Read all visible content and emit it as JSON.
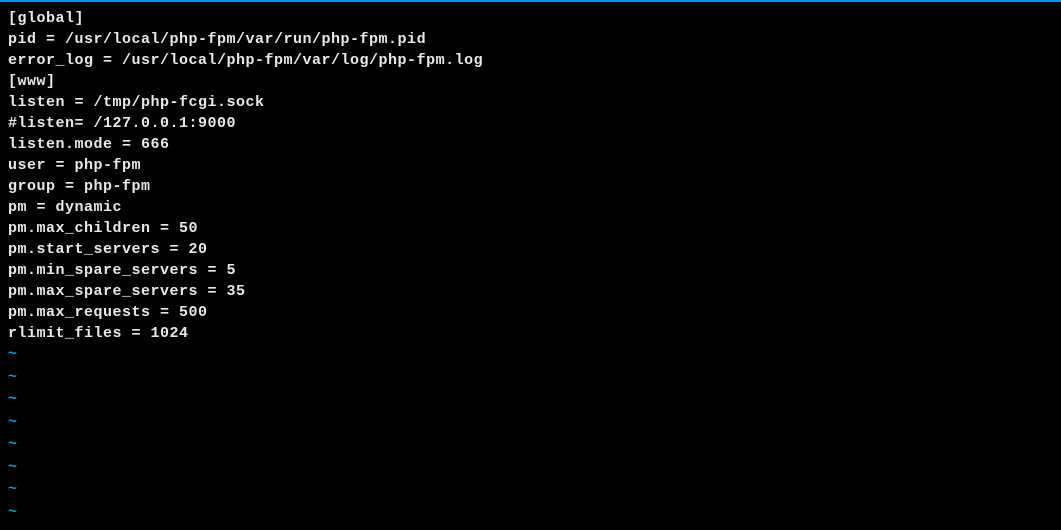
{
  "editor": {
    "lines": [
      "[global]",
      "pid = /usr/local/php-fpm/var/run/php-fpm.pid",
      "error_log = /usr/local/php-fpm/var/log/php-fpm.log",
      "[www]",
      "listen = /tmp/php-fcgi.sock",
      "#listen= /127.0.0.1:9000",
      "listen.mode = 666",
      "user = php-fpm",
      "group = php-fpm",
      "pm = dynamic",
      "pm.max_children = 50",
      "pm.start_servers = 20",
      "pm.min_spare_servers = 5",
      "pm.max_spare_servers = 35",
      "pm.max_requests = 500",
      "rlimit_files = 1024"
    ],
    "tilde_count": 8,
    "tilde_char": "~"
  }
}
